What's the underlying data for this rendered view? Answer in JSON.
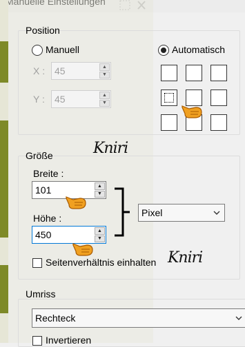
{
  "window": {
    "title": "Manuelle Einstellungen"
  },
  "position": {
    "group_label": "Position",
    "manuell_label": "Manuell",
    "automatisch_label": "Automatisch",
    "selected_mode": "Automatisch",
    "x_label": "X :",
    "x_value": "45",
    "y_label": "Y :",
    "y_value": "45",
    "anchor_selected": "middle-left"
  },
  "size": {
    "group_label": "Größe",
    "breite_label": "Breite :",
    "breite_value": "101",
    "hoehe_label": "Höhe :",
    "hoehe_value": "450",
    "unit_value": "Pixel",
    "aspect_label": "Seitenverhältnis einhalten",
    "aspect_checked": false
  },
  "outline": {
    "group_label": "Umriss",
    "shape_value": "Rechteck",
    "invert_label": "Invertieren",
    "invert_checked": false
  },
  "watermark": {
    "text": "Kniri"
  },
  "colors": {
    "accent": "#0078d7",
    "olive": "#7e8a28",
    "hand": "#f0a020"
  }
}
